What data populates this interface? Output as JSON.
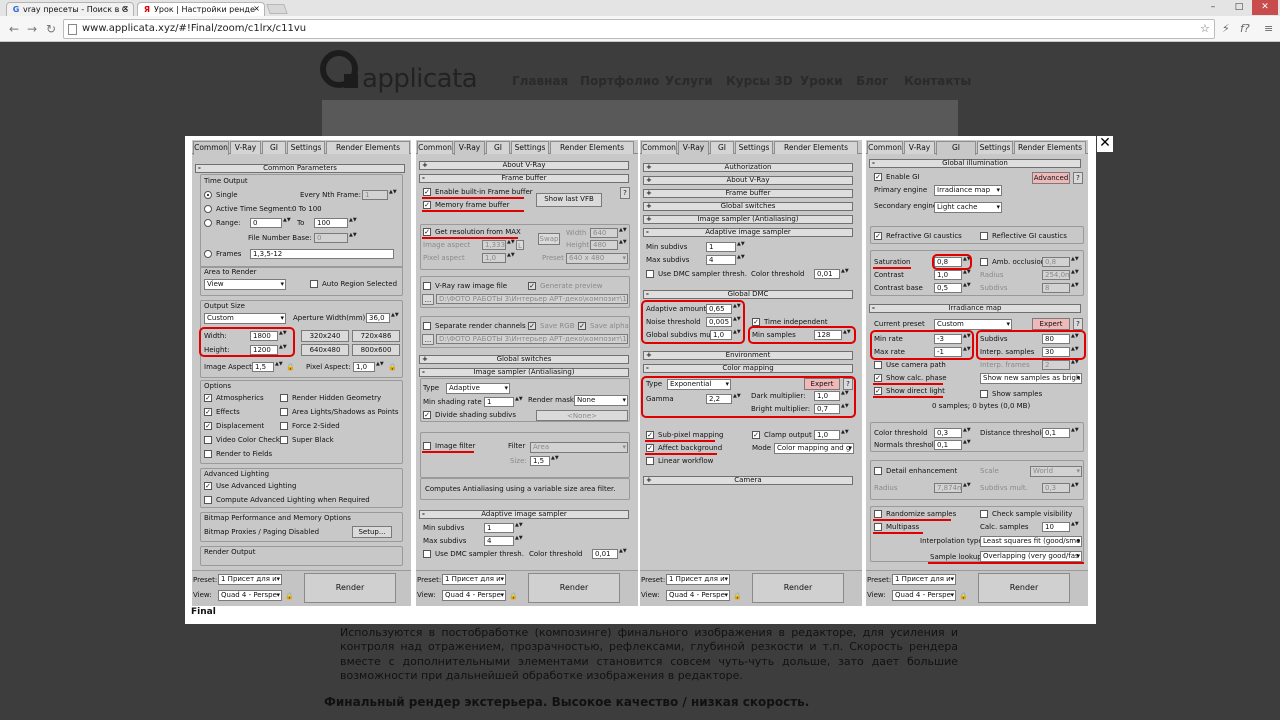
{
  "browser": {
    "tabs": [
      {
        "favicon": "G",
        "title": "vray пресеты - Поиск в G"
      },
      {
        "favicon": "Я",
        "title": "Урок | Настройки ренде"
      }
    ],
    "url": "www.applicata.xyz/#!Final/zoom/c1lrx/c11vu",
    "window_controls": [
      "–",
      "□",
      "✕"
    ],
    "toolbar_icons": [
      "☆",
      "⚡",
      "f?",
      "≡"
    ]
  },
  "site": {
    "brand": "applicata",
    "nav": [
      "Главная",
      "Портфолио",
      "Услуги",
      "Курсы 3D",
      "Уроки",
      "Блог",
      "Контакты"
    ],
    "article": "Используются в постобработке (композинге) финального изображения в редакторе, для усиления и контроля над отражением, прозрачностью, рефлексами, глубиной резкости и т.п. Скорость рендера вместе с дополнительными элементами становится совсем чуть-чуть дольше, зато дает большие возможности при дальнейшей обработке изображения в редакторе.",
    "subheading": "Финальный рендер экстерьера. Высокое качество / низкая скорость."
  },
  "modal": {
    "close": "✕",
    "caption": "Final"
  },
  "tabs": [
    "Common",
    "V-Ray",
    "GI",
    "Settings",
    "Render Elements"
  ],
  "bottom": {
    "preset_label": "Preset:",
    "preset_value": "1 Присет для и",
    "view_label": "View:",
    "view_value": "Quad 4 - Perspe",
    "render": "Render"
  },
  "p1": {
    "roll": "Common Parameters",
    "time_output": "Time Output",
    "single": "Single",
    "every_nth": "Every Nth Frame:",
    "every_nth_val": "1",
    "active_seg": "Active Time Segment:",
    "active_seg_val": "0 To 100",
    "range": "Range:",
    "range_from": "0",
    "to": "To",
    "range_to": "100",
    "fnb": "File Number Base:",
    "fnb_val": "0",
    "frames": "Frames",
    "frames_val": "1,3,5-12",
    "area": "Area to Render",
    "area_val": "View",
    "auto_region": "Auto Region Selected",
    "output_size": "Output Size",
    "custom": "Custom",
    "aperture": "Aperture Width(mm):",
    "aperture_val": "36,0",
    "width": "Width:",
    "width_val": "1800",
    "height": "Height:",
    "height_val": "1200",
    "sizes": [
      "320x240",
      "720x486",
      "640x480",
      "800x600"
    ],
    "img_aspect": "Image Aspect:",
    "img_aspect_val": "1,5",
    "pix_aspect": "Pixel Aspect:",
    "pix_aspect_val": "1,0",
    "options": "Options",
    "opts": [
      "Atmospherics",
      "Render Hidden Geometry",
      "Effects",
      "Area Lights/Shadows as Points",
      "Displacement",
      "Force 2-Sided",
      "Video Color Check",
      "Super Black",
      "Render to Fields"
    ],
    "adv_light": "Advanced Lighting",
    "use_adv": "Use Advanced Lighting",
    "compute_adv": "Compute Advanced Lighting when Required",
    "bitmap": "Bitmap Performance and Memory Options",
    "bitmap_proxies": "Bitmap Proxies / Paging Disabled",
    "setup": "Setup...",
    "render_output": "Render Output"
  },
  "p2": {
    "about": "About V-Ray",
    "frame_buffer": "Frame buffer",
    "enable_fb": "Enable built-in Frame buffer",
    "mem_fb": "Memory frame buffer",
    "show_vfb": "Show last VFB",
    "get_res": "Get resolution from MAX",
    "swap": "Swap",
    "width": "Width",
    "width_val": "640",
    "height": "Height",
    "height_val": "480",
    "img_aspect": "Image aspect",
    "img_aspect_val": "1,333",
    "l": "L",
    "pix_aspect": "Pixel aspect",
    "pix_aspect_val": "1,0",
    "preset": "Preset",
    "preset_val": "640 x 480",
    "raw": "V-Ray raw image file",
    "gen_preview": "Generate preview",
    "raw_path": "D:\\ФОТО РАБОТЫ 3\\Интерьер АРТ-деко\\композит\\1.exr",
    "sep": "Separate render channels",
    "save_rgb": "Save RGB",
    "save_alpha": "Save alpha",
    "sep_path": "D:\\ФОТО РАБОТЫ 3\\Интерьер АРТ-деко\\композит\\1.exr",
    "global_sw": "Global switches",
    "img_sampler": "Image sampler (Antialiasing)",
    "type": "Type",
    "type_val": "Adaptive",
    "min_shading": "Min shading rate",
    "min_shading_val": "1",
    "render_mask": "Render mask",
    "render_mask_val": "None",
    "divide": "Divide shading subdivs",
    "none_tag": "<None>",
    "img_filter": "Image filter",
    "filter": "Filter",
    "filter_val": "Area",
    "size": "Size:",
    "size_val": "1,5",
    "computes": "Computes Antialiasing using a variable size area filter.",
    "adaptive": "Adaptive image sampler",
    "min_subdivs": "Min subdivs",
    "min_subdivs_val": "1",
    "max_subdivs": "Max subdivs",
    "max_subdivs_val": "4",
    "use_dmc": "Use DMC sampler thresh.",
    "color_thr": "Color threshold",
    "color_thr_val": "0,01"
  },
  "p3": {
    "authorization": "Authorization",
    "about": "About V-Ray",
    "frame_buffer": "Frame buffer",
    "global_sw": "Global switches",
    "img_sampler": "Image sampler (Antialiasing)",
    "adaptive": "Adaptive image sampler",
    "min_subdivs": "Min subdivs",
    "min_subdivs_val": "1",
    "max_subdivs": "Max subdivs",
    "max_subdivs_val": "4",
    "use_dmc": "Use DMC sampler thresh.",
    "color_thr": "Color threshold",
    "color_thr_val": "0,01",
    "global_dmc": "Global DMC",
    "adaptive_amount": "Adaptive amount",
    "adaptive_amount_val": "0,65",
    "noise": "Noise threshold",
    "noise_val": "0,005",
    "time_indep": "Time independent",
    "gsm": "Global subdivs mult.",
    "gsm_val": "1,0",
    "min_samples": "Min samples",
    "min_samples_val": "128",
    "environment": "Environment",
    "color_mapping": "Color mapping",
    "type": "Type",
    "type_val": "Exponential",
    "expert": "Expert",
    "help": "?",
    "gamma": "Gamma",
    "gamma_val": "2,2",
    "dark": "Dark multiplier:",
    "dark_val": "1,0",
    "bright": "Bright multiplier:",
    "bright_val": "0,7",
    "subpixel": "Sub-pixel mapping",
    "clamp": "Clamp output",
    "clamp_val": "1,0",
    "affect_bg": "Affect background",
    "mode": "Mode",
    "mode_val": "Color mapping and g",
    "linear": "Linear workflow",
    "camera": "Camera"
  },
  "p4": {
    "gi": "Global illumination",
    "enable": "Enable GI",
    "advanced": "Advanced",
    "primary": "Primary engine",
    "primary_val": "Irradiance map",
    "secondary": "Secondary engine",
    "secondary_val": "Light cache",
    "refr": "Refractive GI caustics",
    "refl": "Reflective GI caustics",
    "saturation": "Saturation",
    "saturation_val": "0,8",
    "amb": "Amb. occlusion",
    "amb_val": "0,8",
    "contrast": "Contrast",
    "contrast_val": "1,0",
    "radius": "Radius",
    "radius_val": "254,0mm",
    "contrast_base": "Contrast base",
    "contrast_base_val": "0,5",
    "subdivs": "Subdivs",
    "subdivs_val": "8",
    "irr": "Irradiance map",
    "current_preset": "Current preset",
    "current_preset_val": "Custom",
    "expert": "Expert",
    "help": "?",
    "min_rate": "Min rate",
    "min_rate_val": "-3",
    "subdivs2": "Subdivs",
    "subdivs2_val": "80",
    "max_rate": "Max rate",
    "max_rate_val": "-1",
    "interp": "Interp. samples",
    "interp_val": "30",
    "use_cam": "Use camera path",
    "interp_frames": "Interp. frames",
    "interp_frames_val": "2",
    "show_calc": "Show calc. phase",
    "show_new": "Show new samples as brigh",
    "show_direct": "Show direct light",
    "show_samples": "Show samples",
    "samples_info": "0 samples; 0 bytes (0,0 MB)",
    "color_thr": "Color threshold",
    "color_thr_val": "0,3",
    "dist_thr": "Distance threshold",
    "dist_thr_val": "0,1",
    "normals_thr": "Normals threshold",
    "normals_thr_val": "0,1",
    "detail": "Detail enhancement",
    "scale": "Scale",
    "scale_val": "World",
    "radius2": "Radius",
    "radius2_val": "7,874mm",
    "subdivs_mult": "Subdivs mult.",
    "subdivs_mult_val": "0,3",
    "randomize": "Randomize samples",
    "check_vis": "Check sample visibility",
    "multipass": "Multipass",
    "calc_samples": "Calc. samples",
    "calc_samples_val": "10",
    "interp_type": "Interpolation type",
    "interp_type_val": "Least squares fit (good/smo",
    "sample_lookup": "Sample lookup",
    "sample_lookup_val": "Overlapping (very good/fas"
  },
  "colors": {
    "highlight": "#e00000",
    "panel": "#c8c8c8"
  }
}
